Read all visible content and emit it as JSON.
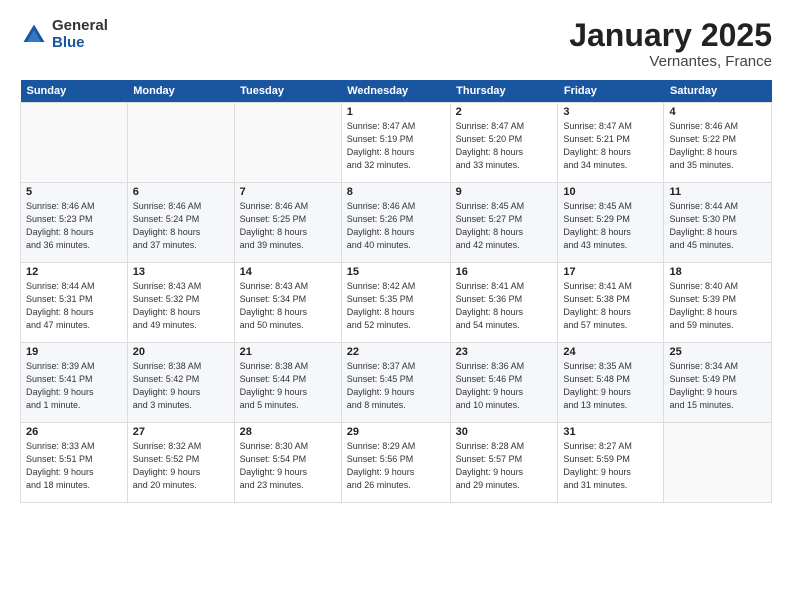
{
  "logo": {
    "general": "General",
    "blue": "Blue"
  },
  "title": "January 2025",
  "subtitle": "Vernantes, France",
  "days_of_week": [
    "Sunday",
    "Monday",
    "Tuesday",
    "Wednesday",
    "Thursday",
    "Friday",
    "Saturday"
  ],
  "weeks": [
    [
      {
        "day": "",
        "info": ""
      },
      {
        "day": "",
        "info": ""
      },
      {
        "day": "",
        "info": ""
      },
      {
        "day": "1",
        "info": "Sunrise: 8:47 AM\nSunset: 5:19 PM\nDaylight: 8 hours\nand 32 minutes."
      },
      {
        "day": "2",
        "info": "Sunrise: 8:47 AM\nSunset: 5:20 PM\nDaylight: 8 hours\nand 33 minutes."
      },
      {
        "day": "3",
        "info": "Sunrise: 8:47 AM\nSunset: 5:21 PM\nDaylight: 8 hours\nand 34 minutes."
      },
      {
        "day": "4",
        "info": "Sunrise: 8:46 AM\nSunset: 5:22 PM\nDaylight: 8 hours\nand 35 minutes."
      }
    ],
    [
      {
        "day": "5",
        "info": "Sunrise: 8:46 AM\nSunset: 5:23 PM\nDaylight: 8 hours\nand 36 minutes."
      },
      {
        "day": "6",
        "info": "Sunrise: 8:46 AM\nSunset: 5:24 PM\nDaylight: 8 hours\nand 37 minutes."
      },
      {
        "day": "7",
        "info": "Sunrise: 8:46 AM\nSunset: 5:25 PM\nDaylight: 8 hours\nand 39 minutes."
      },
      {
        "day": "8",
        "info": "Sunrise: 8:46 AM\nSunset: 5:26 PM\nDaylight: 8 hours\nand 40 minutes."
      },
      {
        "day": "9",
        "info": "Sunrise: 8:45 AM\nSunset: 5:27 PM\nDaylight: 8 hours\nand 42 minutes."
      },
      {
        "day": "10",
        "info": "Sunrise: 8:45 AM\nSunset: 5:29 PM\nDaylight: 8 hours\nand 43 minutes."
      },
      {
        "day": "11",
        "info": "Sunrise: 8:44 AM\nSunset: 5:30 PM\nDaylight: 8 hours\nand 45 minutes."
      }
    ],
    [
      {
        "day": "12",
        "info": "Sunrise: 8:44 AM\nSunset: 5:31 PM\nDaylight: 8 hours\nand 47 minutes."
      },
      {
        "day": "13",
        "info": "Sunrise: 8:43 AM\nSunset: 5:32 PM\nDaylight: 8 hours\nand 49 minutes."
      },
      {
        "day": "14",
        "info": "Sunrise: 8:43 AM\nSunset: 5:34 PM\nDaylight: 8 hours\nand 50 minutes."
      },
      {
        "day": "15",
        "info": "Sunrise: 8:42 AM\nSunset: 5:35 PM\nDaylight: 8 hours\nand 52 minutes."
      },
      {
        "day": "16",
        "info": "Sunrise: 8:41 AM\nSunset: 5:36 PM\nDaylight: 8 hours\nand 54 minutes."
      },
      {
        "day": "17",
        "info": "Sunrise: 8:41 AM\nSunset: 5:38 PM\nDaylight: 8 hours\nand 57 minutes."
      },
      {
        "day": "18",
        "info": "Sunrise: 8:40 AM\nSunset: 5:39 PM\nDaylight: 8 hours\nand 59 minutes."
      }
    ],
    [
      {
        "day": "19",
        "info": "Sunrise: 8:39 AM\nSunset: 5:41 PM\nDaylight: 9 hours\nand 1 minute."
      },
      {
        "day": "20",
        "info": "Sunrise: 8:38 AM\nSunset: 5:42 PM\nDaylight: 9 hours\nand 3 minutes."
      },
      {
        "day": "21",
        "info": "Sunrise: 8:38 AM\nSunset: 5:44 PM\nDaylight: 9 hours\nand 5 minutes."
      },
      {
        "day": "22",
        "info": "Sunrise: 8:37 AM\nSunset: 5:45 PM\nDaylight: 9 hours\nand 8 minutes."
      },
      {
        "day": "23",
        "info": "Sunrise: 8:36 AM\nSunset: 5:46 PM\nDaylight: 9 hours\nand 10 minutes."
      },
      {
        "day": "24",
        "info": "Sunrise: 8:35 AM\nSunset: 5:48 PM\nDaylight: 9 hours\nand 13 minutes."
      },
      {
        "day": "25",
        "info": "Sunrise: 8:34 AM\nSunset: 5:49 PM\nDaylight: 9 hours\nand 15 minutes."
      }
    ],
    [
      {
        "day": "26",
        "info": "Sunrise: 8:33 AM\nSunset: 5:51 PM\nDaylight: 9 hours\nand 18 minutes."
      },
      {
        "day": "27",
        "info": "Sunrise: 8:32 AM\nSunset: 5:52 PM\nDaylight: 9 hours\nand 20 minutes."
      },
      {
        "day": "28",
        "info": "Sunrise: 8:30 AM\nSunset: 5:54 PM\nDaylight: 9 hours\nand 23 minutes."
      },
      {
        "day": "29",
        "info": "Sunrise: 8:29 AM\nSunset: 5:56 PM\nDaylight: 9 hours\nand 26 minutes."
      },
      {
        "day": "30",
        "info": "Sunrise: 8:28 AM\nSunset: 5:57 PM\nDaylight: 9 hours\nand 29 minutes."
      },
      {
        "day": "31",
        "info": "Sunrise: 8:27 AM\nSunset: 5:59 PM\nDaylight: 9 hours\nand 31 minutes."
      },
      {
        "day": "",
        "info": ""
      }
    ]
  ]
}
